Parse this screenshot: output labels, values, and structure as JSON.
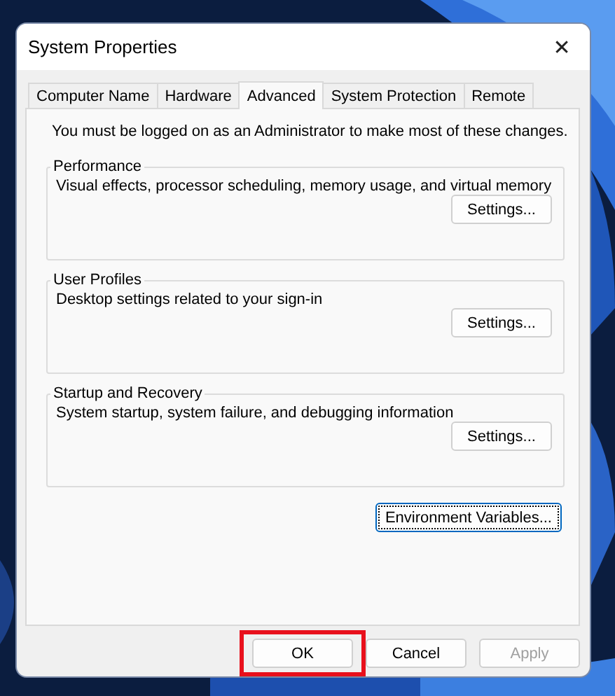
{
  "window": {
    "title": "System Properties",
    "close": "✕"
  },
  "tabs": [
    {
      "label": "Computer Name",
      "selected": false
    },
    {
      "label": "Hardware",
      "selected": false
    },
    {
      "label": "Advanced",
      "selected": true
    },
    {
      "label": "System Protection",
      "selected": false
    },
    {
      "label": "Remote",
      "selected": false
    }
  ],
  "notice": "You must be logged on as an Administrator to make most of these changes.",
  "groups": [
    {
      "title": "Performance",
      "description": "Visual effects, processor scheduling, memory usage, and virtual memory",
      "button": "Settings..."
    },
    {
      "title": "User Profiles",
      "description": "Desktop settings related to your sign-in",
      "button": "Settings..."
    },
    {
      "title": "Startup and Recovery",
      "description": "System startup, system failure, and debugging information",
      "button": "Settings..."
    }
  ],
  "environment_button": {
    "label": "Environment Variables...",
    "focused": true
  },
  "buttons": [
    {
      "label": "OK",
      "disabled": false,
      "highlighted": true
    },
    {
      "label": "Cancel",
      "disabled": false,
      "highlighted": false
    },
    {
      "label": "Apply",
      "disabled": true,
      "highlighted": false
    }
  ]
}
